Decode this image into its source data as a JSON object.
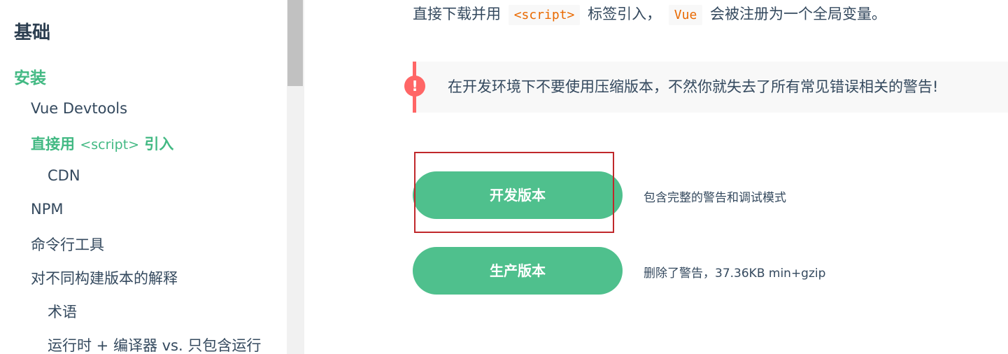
{
  "sidebar": {
    "section_title": "基础",
    "items": [
      {
        "label": "安装"
      },
      {
        "label": "Vue Devtools"
      },
      {
        "label_before": "直接用 ",
        "label_code": "<script>",
        "label_after": " 引入"
      },
      {
        "label": "CDN"
      },
      {
        "label": "NPM"
      },
      {
        "label": "命令行工具"
      },
      {
        "label": "对不同构建版本的解释"
      },
      {
        "label": "术语"
      },
      {
        "label": "运行时 + 编译器 vs. 只包含运行"
      }
    ]
  },
  "main": {
    "intro": {
      "text_before": "直接下载并用",
      "code1": "<script>",
      "text_middle": "标签引入，",
      "code2": "Vue",
      "text_after": "会被注册为一个全局变量。"
    },
    "warning": {
      "icon": "!",
      "text": "在开发环境下不要使用压缩版本，不然你就失去了所有常见错误相关的警告!"
    },
    "downloads": [
      {
        "label": "开发版本",
        "description": "包含完整的警告和调试模式"
      },
      {
        "label": "生产版本",
        "description": "删除了警告，37.36KB min+gzip"
      }
    ]
  },
  "colors": {
    "accent": "#42b983",
    "button": "#4fc08d",
    "warning": "#ff6666",
    "highlight": "#c0282b"
  }
}
